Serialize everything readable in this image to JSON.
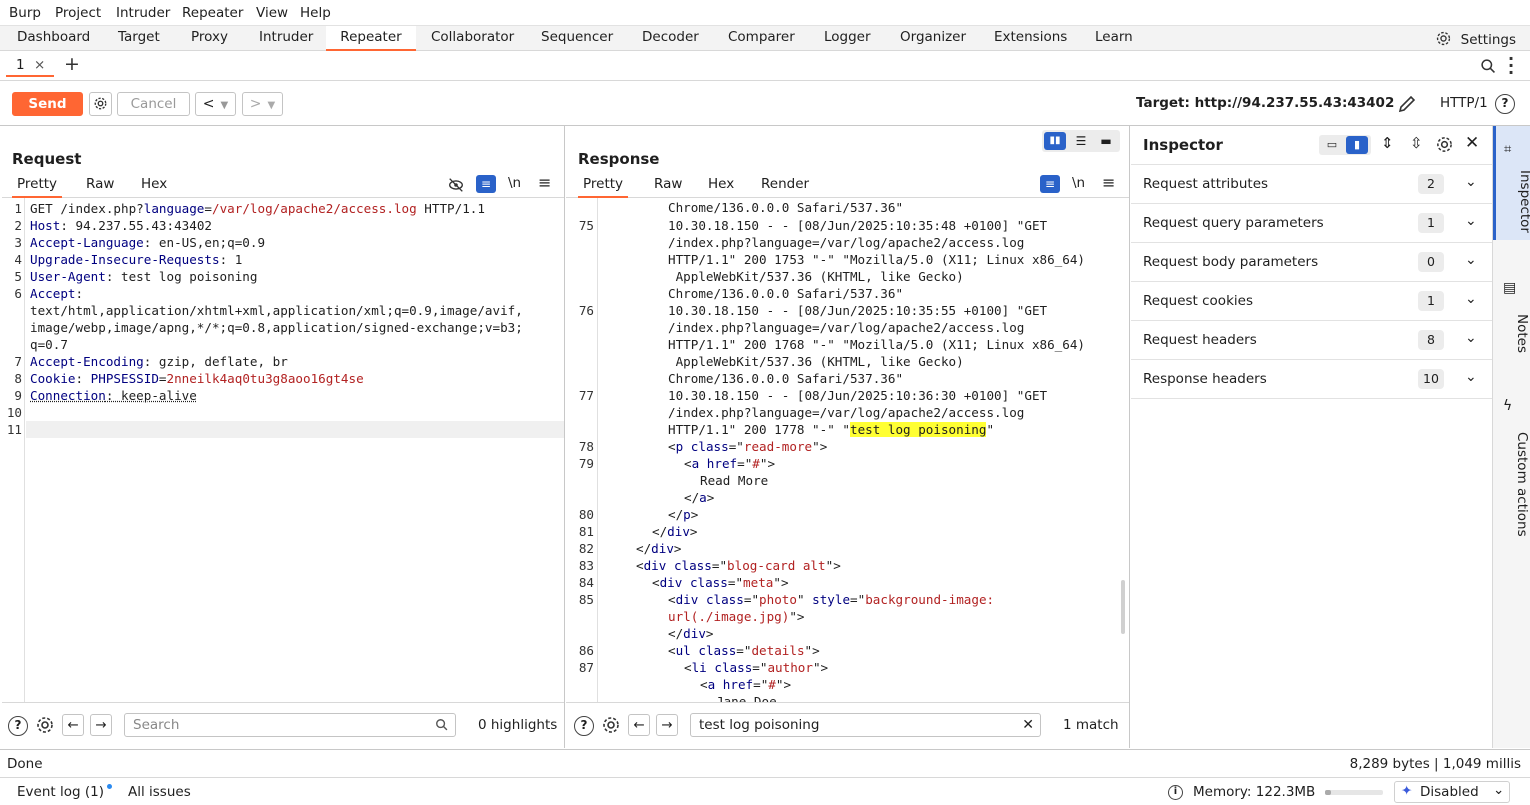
{
  "menu": [
    "Burp",
    "Project",
    "Intruder",
    "Repeater",
    "View",
    "Help"
  ],
  "tabs": [
    "Dashboard",
    "Target",
    "Proxy",
    "Intruder",
    "Repeater",
    "Collaborator",
    "Sequencer",
    "Decoder",
    "Comparer",
    "Logger",
    "Organizer",
    "Extensions",
    "Learn"
  ],
  "active_tab": "Repeater",
  "settings_label": "Settings",
  "repeater_tab": {
    "label": "1",
    "close": "×"
  },
  "toolbar": {
    "send": "Send",
    "cancel": "Cancel",
    "target": "Target: http://94.237.55.43:43402",
    "protocol": "HTTP/1"
  },
  "request": {
    "title": "Request",
    "tabs": [
      "Pretty",
      "Raw",
      "Hex"
    ],
    "newline_toggle": "\\n",
    "search_placeholder": "Search",
    "highlights": "0 highlights"
  },
  "response": {
    "title": "Response",
    "tabs": [
      "Pretty",
      "Raw",
      "Hex",
      "Render"
    ],
    "newline_toggle": "\\n",
    "search_value": "test log poisoning",
    "matches": "1 match"
  },
  "inspector": {
    "title": "Inspector",
    "sections": [
      {
        "label": "Request attributes",
        "count": "2"
      },
      {
        "label": "Request query parameters",
        "count": "1"
      },
      {
        "label": "Request body parameters",
        "count": "0"
      },
      {
        "label": "Request cookies",
        "count": "1"
      },
      {
        "label": "Request headers",
        "count": "8"
      },
      {
        "label": "Response headers",
        "count": "10"
      }
    ]
  },
  "side_tabs": [
    "Inspector",
    "Notes",
    "Custom actions"
  ],
  "status": {
    "left": "Done",
    "right": "8,289 bytes | 1,049 millis"
  },
  "bottom": {
    "event_log": "Event log (1)",
    "all_issues": "All issues",
    "memory": "Memory: 122.3MB",
    "disabled": "Disabled"
  }
}
